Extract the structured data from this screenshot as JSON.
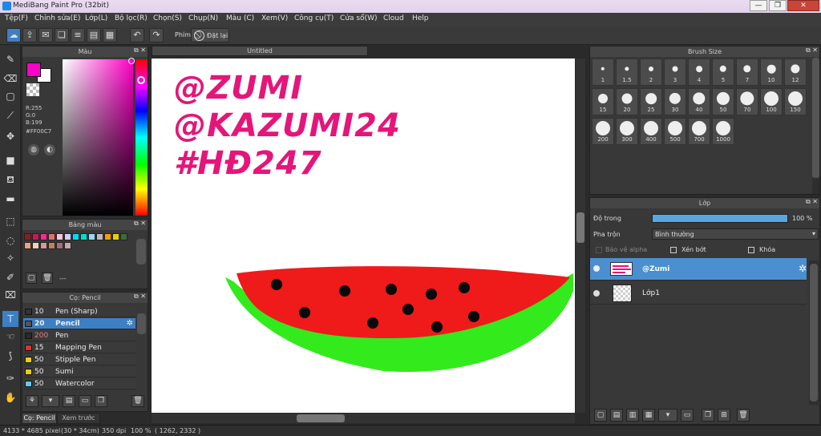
{
  "window": {
    "title": "MediBang Paint Pro (32bit)",
    "minimize": "—",
    "restore": "❐",
    "close": "✕"
  },
  "menu": [
    "Tệp(F)",
    "Chỉnh sửa(E)",
    "Lớp(L)",
    "Bộ lọc(R)",
    "Chọn(S)",
    "Chụp(N)",
    "Màu (C)",
    "Xem(V)",
    "Công cụ(T)",
    "Cửa sổ(W)",
    "Cloud",
    "Help"
  ],
  "toolbar": {
    "phim_label": "Phím",
    "reset_label": "Đặt lại"
  },
  "color_panel": {
    "title": "Màu",
    "rgb": {
      "r": "R:255",
      "g": "G:0",
      "b": "B:199"
    },
    "hex": "#FF00C7",
    "fg_color": "#ff00c7",
    "bg_color": "#ffffff"
  },
  "palette_panel": {
    "title": "Bảng màu",
    "palette_name": "---",
    "colors": [
      "#8a1e1e",
      "#c8185a",
      "#ff2a8a",
      "#e07070",
      "#f8c4d8",
      "#d0d0ff",
      "#00d8ff",
      "#00e0c8",
      "#9ed4ff",
      "#bababa",
      "#ff9a00",
      "#e8d000",
      "#3c6c3c",
      "#f0a070",
      "#f4d0b0",
      "#d09a9a",
      "#c08060",
      "#a07080",
      "#c8a8a8"
    ]
  },
  "brush_panel": {
    "title": "Cọ: Pencil",
    "items": [
      {
        "size": "10",
        "name": "Pen (Sharp)",
        "color": "#333333",
        "selected": false
      },
      {
        "size": "20",
        "name": "Pencil",
        "color": "#555555",
        "selected": true
      },
      {
        "size": "200",
        "name": "Pen",
        "color": "#2a2a2a",
        "selected": false
      },
      {
        "size": "15",
        "name": "Mapping Pen",
        "color": "#e03030",
        "selected": false
      },
      {
        "size": "50",
        "name": "Stipple Pen",
        "color": "#e8d000",
        "selected": false
      },
      {
        "size": "50",
        "name": "Sumi",
        "color": "#e8d000",
        "selected": false
      },
      {
        "size": "50",
        "name": "Watercolor",
        "color": "#60c8ff",
        "selected": false
      }
    ]
  },
  "bottom_tabs": [
    "Cọ: Pencil",
    "Xem trước cọ"
  ],
  "canvas": {
    "tab_title": "Untitled",
    "text_lines": [
      "@ZUMI",
      "@KAZUMI24",
      "#HĐ247"
    ],
    "text_color": "#e5157a"
  },
  "brush_size_panel": {
    "title": "Brush Size",
    "sizes": [
      "1",
      "1.5",
      "2",
      "3",
      "4",
      "5",
      "7",
      "10",
      "12",
      "15",
      "20",
      "25",
      "30",
      "40",
      "50",
      "70",
      "100",
      "150",
      "200",
      "300",
      "400",
      "500",
      "700",
      "1000"
    ]
  },
  "layer_panel": {
    "title": "Lớp",
    "opacity_label": "Độ trong",
    "opacity_value": "100 %",
    "opacity_fraction": 1.0,
    "blend_label": "Pha trộn",
    "blend_value": "Bình thường",
    "protect_alpha": "Bảo vệ alpha",
    "clipping": "Xén bớt",
    "lock": "Khóa",
    "layers": [
      {
        "name": "@Zumi",
        "selected": true
      },
      {
        "name": "Lớp1",
        "selected": false
      }
    ]
  },
  "status": {
    "dimensions": "4133 * 4685 pixel",
    "cm": "(30 * 34cm)",
    "dpi": "350 dpi",
    "zoom": "100 %",
    "coords": "( 1262, 2332 )"
  }
}
